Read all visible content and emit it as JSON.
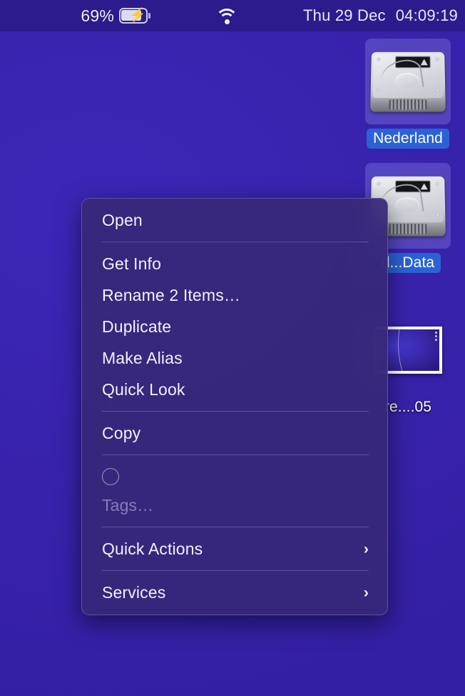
{
  "menubar": {
    "battery_percent": "69%",
    "battery_icon": "battery-charging-icon",
    "display_icon": "airplay-display-icon",
    "wifi_icon": "wifi-icon",
    "control_center_icon": "control-center-icon",
    "date": "Thu 29 Dec",
    "time": "04:09:19"
  },
  "desktop": {
    "icons": [
      {
        "label": "Nederland",
        "type": "hard-drive",
        "selected": true
      },
      {
        "label": "d...Data",
        "type": "hard-drive",
        "selected": true
      },
      {
        "label": "re....05",
        "type": "screenshot-file",
        "selected": false
      }
    ]
  },
  "context_menu": {
    "items": [
      {
        "label": "Open",
        "kind": "item"
      },
      {
        "kind": "separator"
      },
      {
        "label": "Get Info",
        "kind": "item"
      },
      {
        "label": "Rename 2 Items…",
        "kind": "item"
      },
      {
        "label": "Duplicate",
        "kind": "item"
      },
      {
        "label": "Make Alias",
        "kind": "item"
      },
      {
        "label": "Quick Look",
        "kind": "item"
      },
      {
        "kind": "separator"
      },
      {
        "label": "Copy",
        "kind": "item"
      },
      {
        "kind": "separator"
      },
      {
        "label": "Tags…",
        "kind": "tags"
      },
      {
        "kind": "separator"
      },
      {
        "label": "Quick Actions",
        "kind": "submenu",
        "chevron": "›"
      },
      {
        "kind": "separator"
      },
      {
        "label": "Services",
        "kind": "submenu",
        "chevron": "›"
      }
    ]
  },
  "colors": {
    "desktop_background": "#3A24B4",
    "menubar_background": "#2B1B8C",
    "selection_blue": "#2A62D6",
    "menu_background": "#372878",
    "text_primary": "#F3F1FC"
  }
}
